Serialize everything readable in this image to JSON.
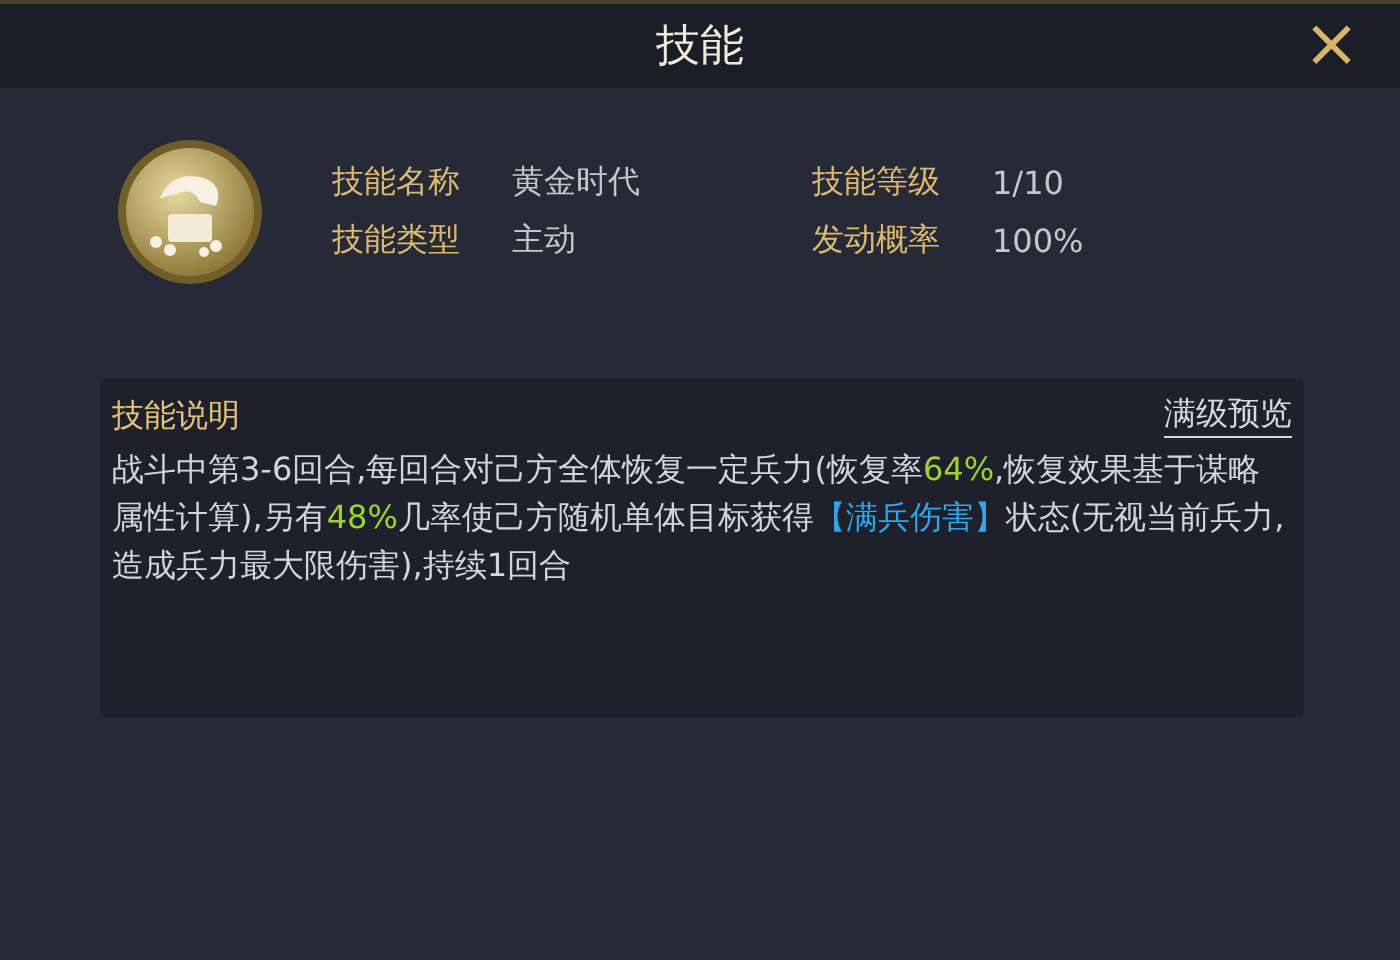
{
  "window": {
    "title": "技能",
    "close": "×"
  },
  "skill_info": [
    {
      "label": "技能名称",
      "value": "黄金时代"
    },
    {
      "label": "技能等级",
      "value": "1/10"
    },
    {
      "label": "技能类型",
      "value": "主动"
    },
    {
      "label": "发动概率",
      "value": "100%"
    }
  ],
  "description": {
    "title": "技能说明",
    "preview_link": "满级预览",
    "segments": [
      {
        "text": "战斗中第3-6回合,每回合对己方全体恢复一定兵力(恢复率",
        "kind": "plain"
      },
      {
        "text": "64%",
        "kind": "value"
      },
      {
        "text": ",恢复效果基于谋略属性计算),另有",
        "kind": "plain"
      },
      {
        "text": "48%",
        "kind": "value"
      },
      {
        "text": "几率使己方随机单体目标获得",
        "kind": "plain"
      },
      {
        "text": "【满兵伤害】",
        "kind": "keyword"
      },
      {
        "text": "状态(无视当前兵力,造成兵力最大限伤害),持续1回合",
        "kind": "plain"
      }
    ]
  }
}
